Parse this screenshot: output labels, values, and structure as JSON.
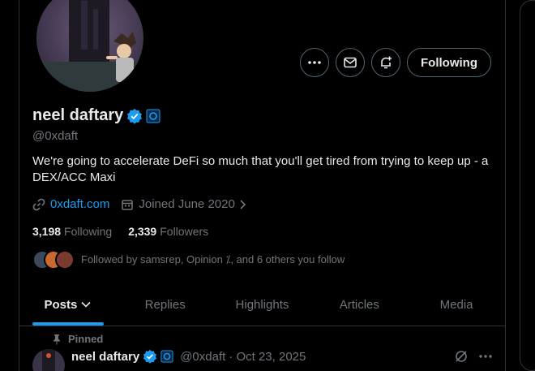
{
  "profile": {
    "display_name": "neel daftary",
    "handle": "@0xdaft",
    "bio": "We're going to accelerate DeFi so much that you'll get tired from trying to keep up - a DEX/ACC Maxi",
    "website": "0xdaft.com",
    "joined": "Joined June 2020"
  },
  "actions": {
    "more_icon": "more-icon",
    "message_icon": "mail-icon",
    "notify_icon": "bell-plus-icon",
    "follow_label": "Following"
  },
  "stats": {
    "following_count": "3,198",
    "following_label": "Following",
    "followers_count": "2,339",
    "followers_label": "Followers"
  },
  "followed_by": {
    "text": "Followed by samsrep, Opinion ⁒, and 6 others you follow"
  },
  "tabs": [
    {
      "label": "Posts"
    },
    {
      "label": "Replies"
    },
    {
      "label": "Highlights"
    },
    {
      "label": "Articles"
    },
    {
      "label": "Media"
    }
  ],
  "pinned_tweet": {
    "pinned_label": "Pinned",
    "author_name": "neel daftary",
    "author_handle": "@0xdaft",
    "date": "· Oct 23, 2025"
  },
  "colors": {
    "accent": "#1d9bf0",
    "muted": "#71767b",
    "text": "#e7e9ea",
    "border": "#2f3336",
    "background": "#000000"
  }
}
